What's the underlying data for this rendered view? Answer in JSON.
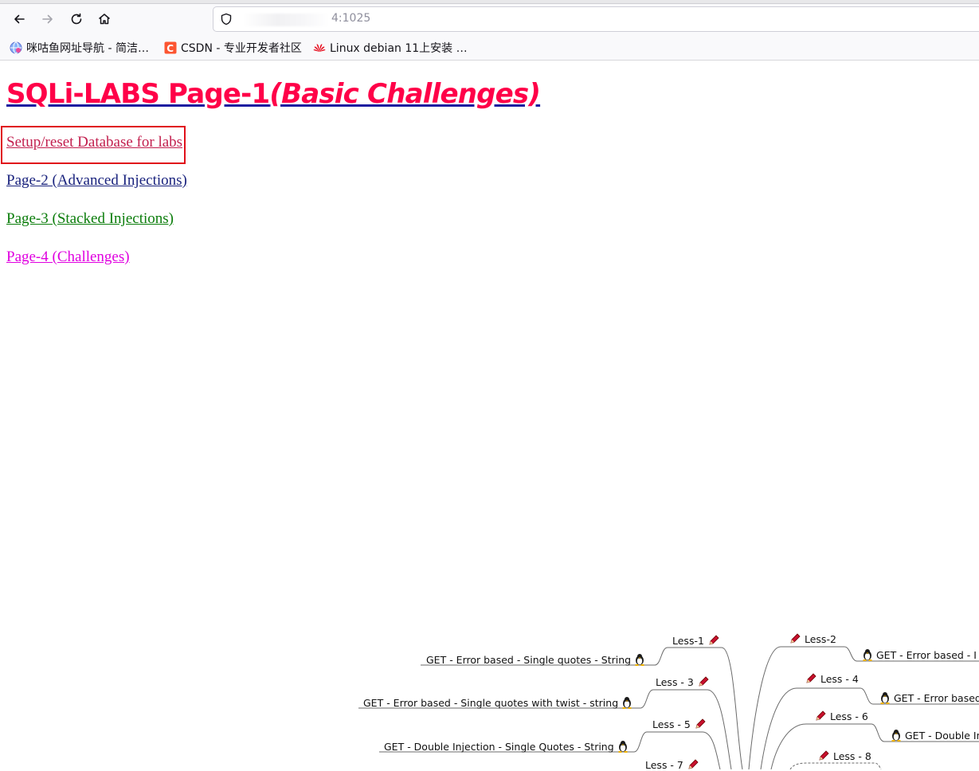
{
  "browser": {
    "url_suffix": "4:1025",
    "bookmarks": [
      {
        "label": "咪咕鱼网址导航 - 简洁…",
        "icon": "globe-icon"
      },
      {
        "label": "CSDN - 专业开发者社区",
        "icon": "csdn-icon"
      },
      {
        "label": "Linux debian 11上安装 …",
        "icon": "huawei-icon"
      }
    ]
  },
  "page": {
    "title_main": "SQLi-LABS Page-1",
    "title_sub": "(Basic Challenges)",
    "links": [
      "Setup/reset Database for labs",
      "Page-2 (Advanced Injections)",
      "Page-3 (Stacked Injections)",
      "Page-4 (Challenges)"
    ]
  },
  "mindmap": {
    "left": [
      {
        "less": "Less-1",
        "desc": "GET - Error based - Single quotes - String"
      },
      {
        "less": "Less - 3",
        "desc": "GET - Error based - Single quotes with twist - string"
      },
      {
        "less": "Less - 5",
        "desc": "GET - Double Injection - Single Quotes - String"
      },
      {
        "less": "Less - 7"
      }
    ],
    "right": [
      {
        "less": "Less-2",
        "desc": "GET - Error based - I"
      },
      {
        "less": "Less - 4",
        "desc": "GET - Error based"
      },
      {
        "less": "Less - 6",
        "desc": "GET - Double In"
      },
      {
        "less": "Less - 8"
      }
    ]
  },
  "colors": {
    "title": "#ff0048",
    "highlight": "#e0101a"
  }
}
